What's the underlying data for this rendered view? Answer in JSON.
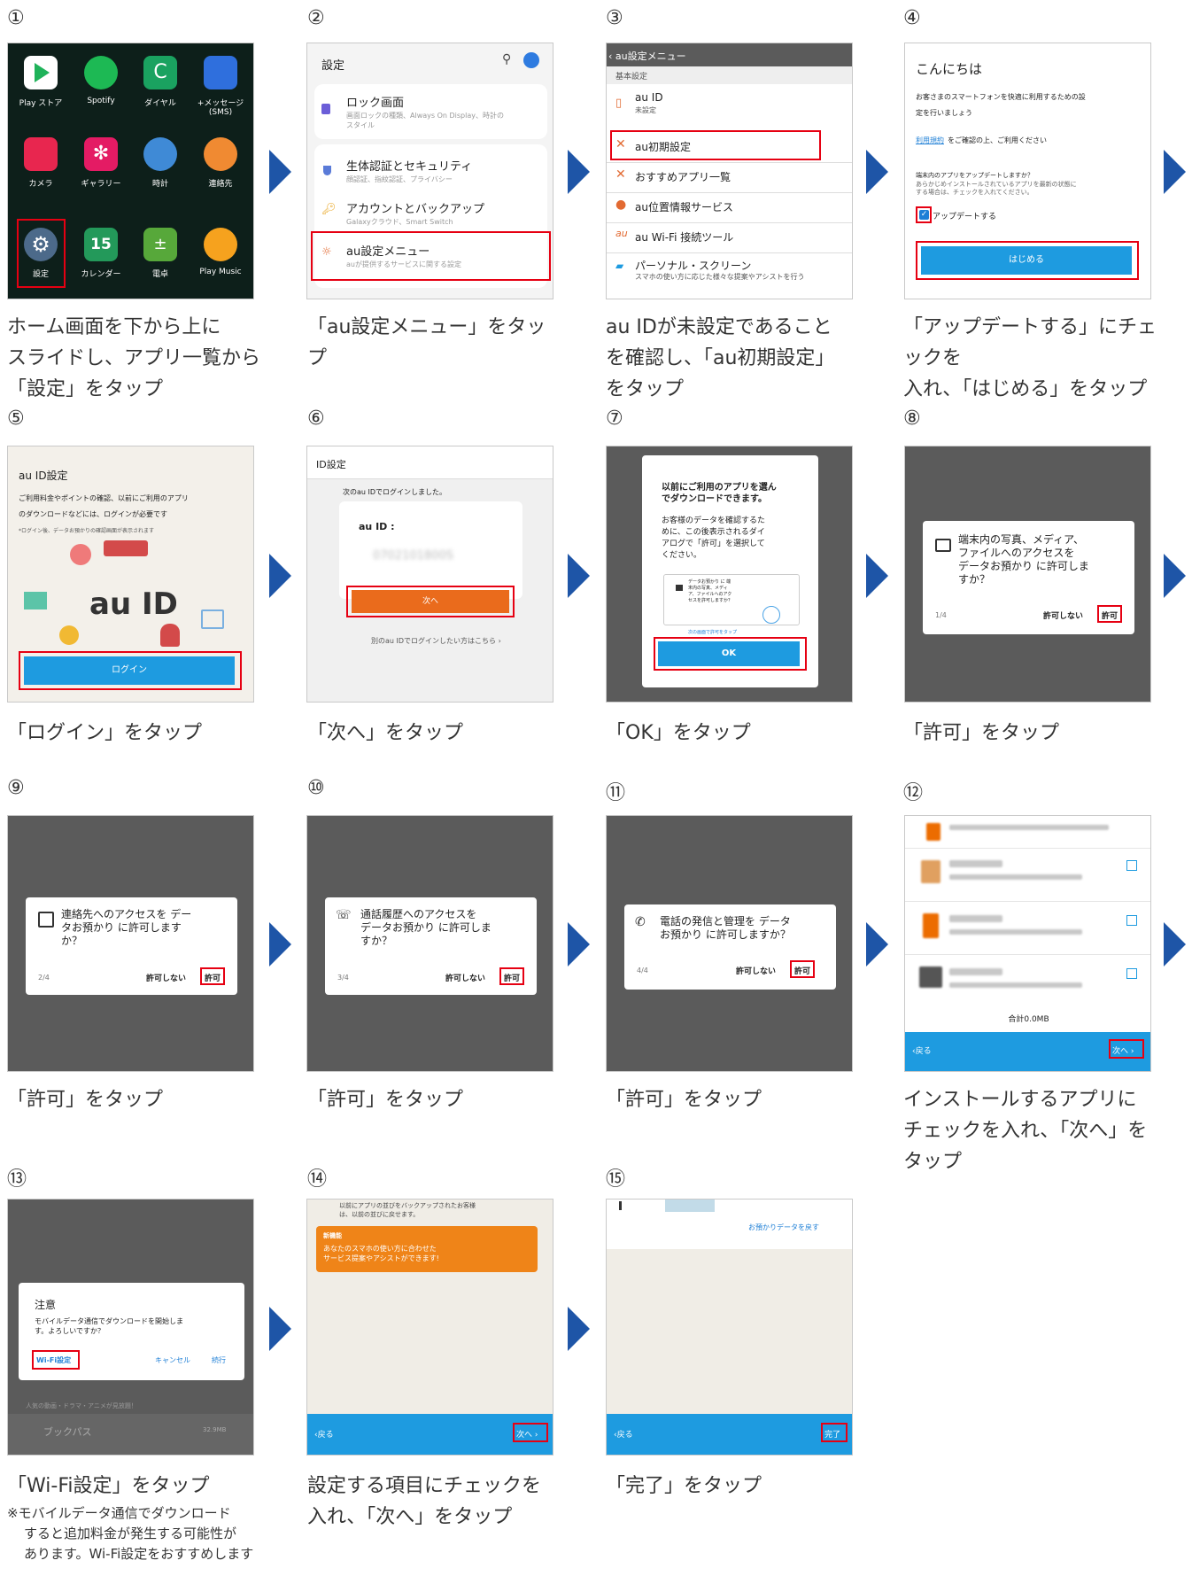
{
  "colors": {
    "arrow": "#1e55a7",
    "highlight": "#e60012",
    "au_orange": "#ec6c00",
    "blue_bar": "#1e9be0"
  },
  "steps": [
    {
      "num": "①",
      "caption": "ホーム画面を下から上に\nスライドし、アプリ一覧から\n「設定」をタップ"
    },
    {
      "num": "②",
      "caption": "「au設定メニュー」をタップ"
    },
    {
      "num": "③",
      "caption": "au IDが未設定であること\nを確認し、「au初期設定」\nをタップ"
    },
    {
      "num": "④",
      "caption": "「アップデートする」にチェックを\n入れ、「はじめる」をタップ"
    },
    {
      "num": "⑤",
      "caption": "「ログイン」をタップ"
    },
    {
      "num": "⑥",
      "caption": "「次へ」をタップ"
    },
    {
      "num": "⑦",
      "caption": "「OK」をタップ"
    },
    {
      "num": "⑧",
      "caption": "「許可」をタップ"
    },
    {
      "num": "⑨",
      "caption": "「許可」をタップ"
    },
    {
      "num": "⑩",
      "caption": "「許可」をタップ"
    },
    {
      "num": "⑪",
      "caption": "「許可」をタップ"
    },
    {
      "num": "⑫",
      "caption": "インストールするアプリに\nチェックを入れ、「次へ」を\nタップ"
    },
    {
      "num": "⑬",
      "caption": "「Wi-Fi設定」をタップ",
      "note": "※モバイルデータ通信でダウンロード\nすると追加料金が発生する可能性が\nあります。Wi-Fi設定をおすすめします"
    },
    {
      "num": "⑭",
      "caption": "設定する項目にチェックを\n入れ、「次へ」をタップ"
    },
    {
      "num": "⑮",
      "caption": "「完了」をタップ"
    }
  ],
  "s1": {
    "apps": [
      "Play ストア",
      "Spotify",
      "ダイヤル",
      "+メッセージ\n(SMS)",
      "カメラ",
      "ギャラリー",
      "時計",
      "連絡先",
      "設定",
      "カレンダー",
      "電卓",
      "Play Music"
    ],
    "calendar_day": "15"
  },
  "s2": {
    "title": "設定",
    "items": [
      {
        "title": "ロック画面",
        "sub": "画面ロックの種類、Always On Display、時計の\nスタイル"
      },
      {
        "title": "生体認証とセキュリティ",
        "sub": "顔認証、指紋認証、プライバシー"
      },
      {
        "title": "アカウントとバックアップ",
        "sub": "Galaxyクラウド、Smart Switch"
      },
      {
        "title": "au設定メニュー",
        "sub": "auが提供するサービスに関する設定"
      }
    ]
  },
  "s3": {
    "header": "‹ au設定メニュー",
    "section": "基本設定",
    "auid": "au ID",
    "auid_status": "未設定",
    "items": [
      "au初期設定",
      "おすすめアプリ一覧",
      "au位置情報サービス",
      "au Wi-Fi 接続ツール",
      "パーソナル・スクリーン"
    ],
    "ps_sub": "スマホの使い方に応じた様々な提案やアシストを行う"
  },
  "s4": {
    "greeting": "こんにちは",
    "intro": "お客さまのスマートフォンを快適に利用するための設\n定を行いましょう",
    "terms_link": "利用規約",
    "terms_rest": "をご確認の上、ご利用ください",
    "q": "端末内のアプリをアップデートしますか？",
    "q_sub": "あらかじめインストールされているアプリを最新の状態に\nする場合は、チェックを入れてください。",
    "check": "アップデートする",
    "button": "はじめる"
  },
  "s5": {
    "title": "au ID設定",
    "text": "ご利用料金やポイントの確認、以前にご利用のアプリ\nのダウンロードなどには、ログインが必要です",
    "small": "*ログイン後、データお預かりの確認画面が表示されます",
    "logo": "au ID",
    "button": "ログイン"
  },
  "s6": {
    "title": "ID設定",
    "msg": "次のau IDでログインしました。",
    "label": "au ID :",
    "value": "0702101800S",
    "button": "次へ",
    "link": "別のau IDでログインしたい方はこちら ›"
  },
  "s7": {
    "title": "以前にご利用のアプリを選ん\nでダウンロードできます。",
    "body": "お客様のデータを確認するた\nめに、この後表示されるダイ\nアログで「許可」を選択して\nください。",
    "mini_text": "データお預かり に 端\n末内の写真、メディ\nア、ファイルへのアク\nセスを許可しますか？",
    "mini_hint": "次の画面で許可をタップ",
    "button": "OK"
  },
  "perm": {
    "deny": "許可しない",
    "allow": "許可"
  },
  "s8": {
    "text": "端末内の写真、メディア、\nファイルへのアクセスを\nデータお預かり に許可しま\nすか？",
    "count": "1/4"
  },
  "s9": {
    "text": "連絡先へのアクセスを デー\nタお預かり に許可します\nか？",
    "count": "2/4"
  },
  "s10": {
    "text": "通話履歴へのアクセスを\nデータお預かり に許可しま\nすか？",
    "count": "3/4"
  },
  "s11": {
    "text": "電話の発信と管理を データ\nお預かり に許可しますか？",
    "count": "4/4"
  },
  "s12": {
    "total": "合計0.0MB",
    "back": "‹戻る",
    "next": "次へ ›"
  },
  "s13": {
    "title": "注意",
    "body": "モバイルデータ通信でダウンロードを開始しま\nす。よろしいですか？",
    "wifi": "Wi-Fi設定",
    "cancel": "キャンセル",
    "cont": "続行",
    "app": "ブックパス",
    "size": "32.9MB",
    "under": "人気の動画・ドラマ・アニメが見放題！"
  },
  "s14": {
    "top": "以前にアプリの並びをバックアップされたお客様\nは、以前の並びに戻せます。",
    "badge": "新機能",
    "orange": "あなたのスマホの使い方に合わせた\nサービス提案やアシストができます!",
    "back": "‹戻る",
    "next": "次へ ›"
  },
  "s15": {
    "link": "お預かりデータを戻す",
    "back": "‹戻る",
    "done": "完了"
  }
}
